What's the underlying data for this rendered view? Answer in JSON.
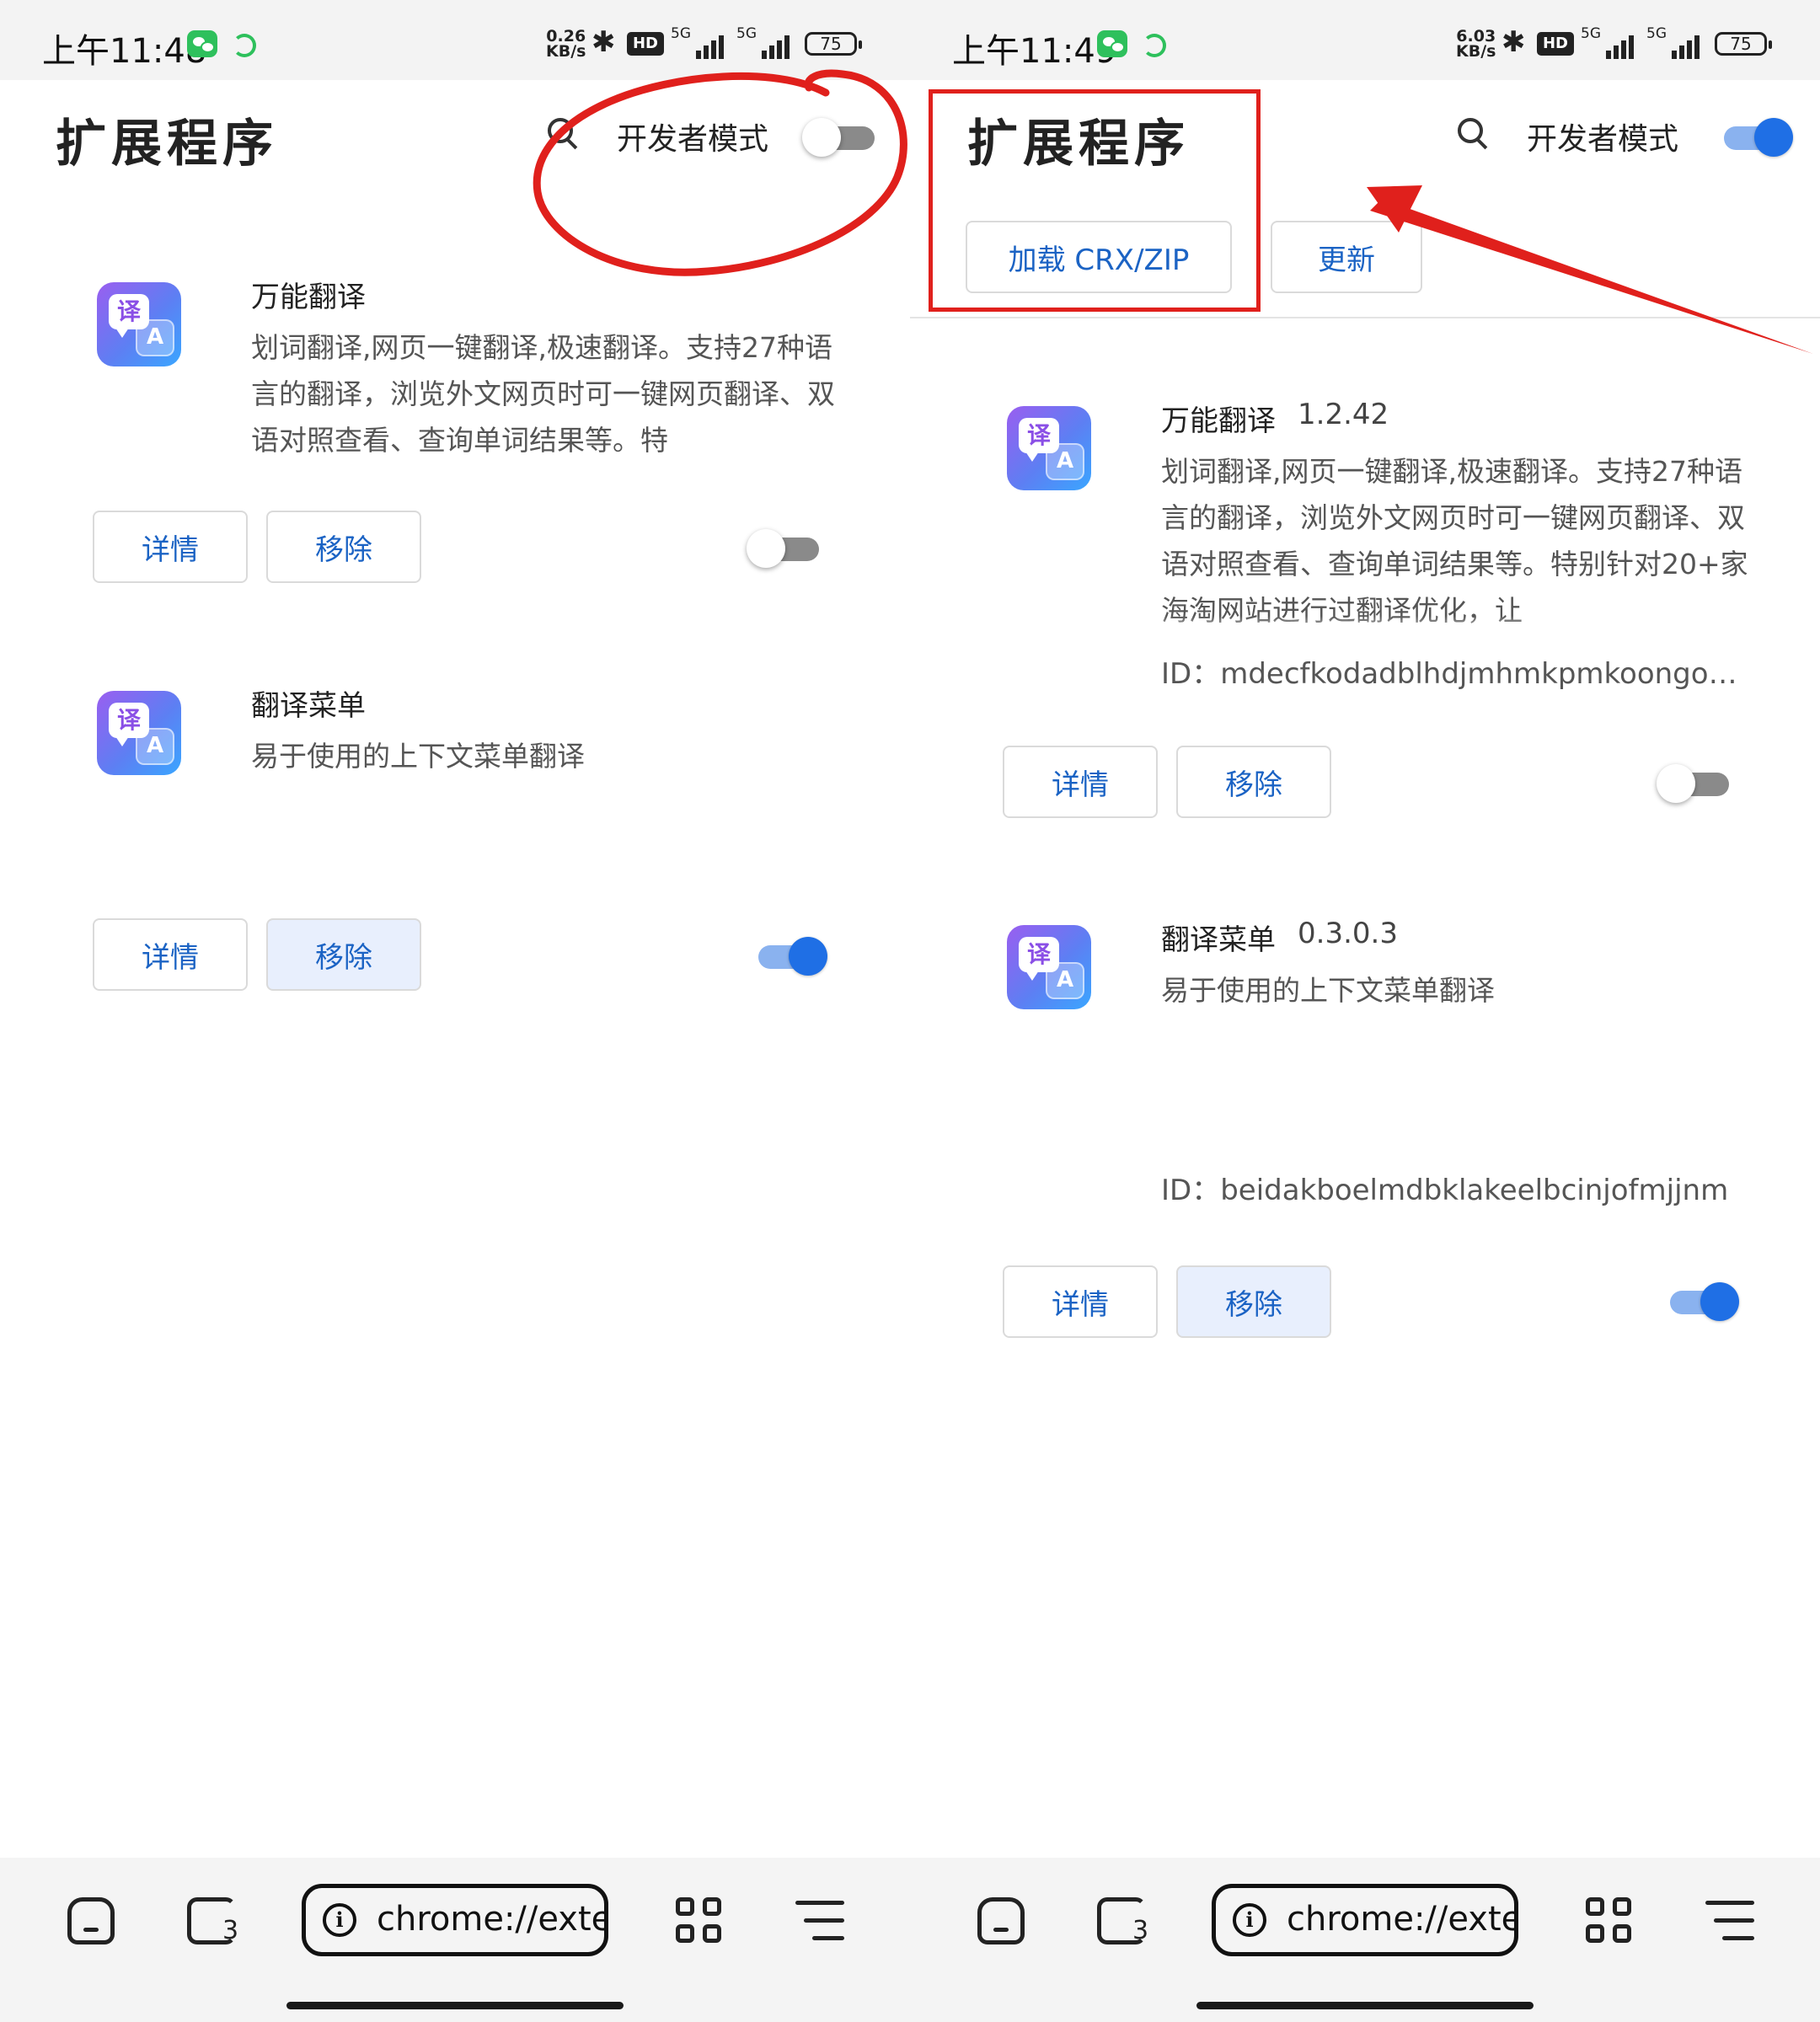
{
  "left": {
    "status": {
      "time": "上午11:48",
      "speed_value": "0.26",
      "speed_unit": "KB/s",
      "hd": "HD",
      "net1": "5G",
      "net2": "5G",
      "battery": "75"
    },
    "header": {
      "title": "扩展程序",
      "dev_mode_label": "开发者模式",
      "dev_mode_on": false
    },
    "extensions": [
      {
        "name": "万能翻译",
        "description": "划词翻译,网页一键翻译,极速翻译。支持27种语言的翻译，浏览外文网页时可一键网页翻译、双语对照查看、查询单词结果等。特",
        "details": "详情",
        "remove": "移除",
        "enabled": false
      },
      {
        "name": "翻译菜单",
        "description": "易于使用的上下文菜单翻译",
        "details": "详情",
        "remove": "移除",
        "enabled": true
      }
    ],
    "bottom": {
      "tabs_count": "3",
      "url": "chrome://extensions"
    }
  },
  "right": {
    "status": {
      "time": "上午11:49",
      "speed_value": "6.03",
      "speed_unit": "KB/s",
      "hd": "HD",
      "net1": "5G",
      "net2": "5G",
      "battery": "75"
    },
    "header": {
      "title": "扩展程序",
      "dev_mode_label": "开发者模式",
      "dev_mode_on": true,
      "load_button": "加载 CRX/ZIP",
      "update_button": "更新"
    },
    "extensions": [
      {
        "name": "万能翻译",
        "version": "1.2.42",
        "description": "划词翻译,网页一键翻译,极速翻译。支持27种语言的翻译，浏览外文网页时可一键网页翻译、双语对照查看、查询单词结果等。特别针对20+家海淘网站进行过翻译优化，让",
        "id": "ID：mdecfkodadblhdjmhmkpmkoongo…",
        "details": "详情",
        "remove": "移除",
        "enabled": false
      },
      {
        "name": "翻译菜单",
        "version": "0.3.0.3",
        "description": "易于使用的上下文菜单翻译",
        "id": "ID：beidakboelmdbklakeelbcinjofmjjnm",
        "details": "详情",
        "remove": "移除",
        "enabled": true
      }
    ],
    "bottom": {
      "tabs_count": "3",
      "url": "chrome://extensions"
    }
  },
  "icons": {
    "extension_icon_glyph": "译",
    "extension_icon_glyph2": "A",
    "info_glyph": "i",
    "bluetooth_glyph": "✱"
  },
  "colors": {
    "accent": "#1f6fe5",
    "annotation": "#e0201c",
    "link": "#1b63c4"
  }
}
